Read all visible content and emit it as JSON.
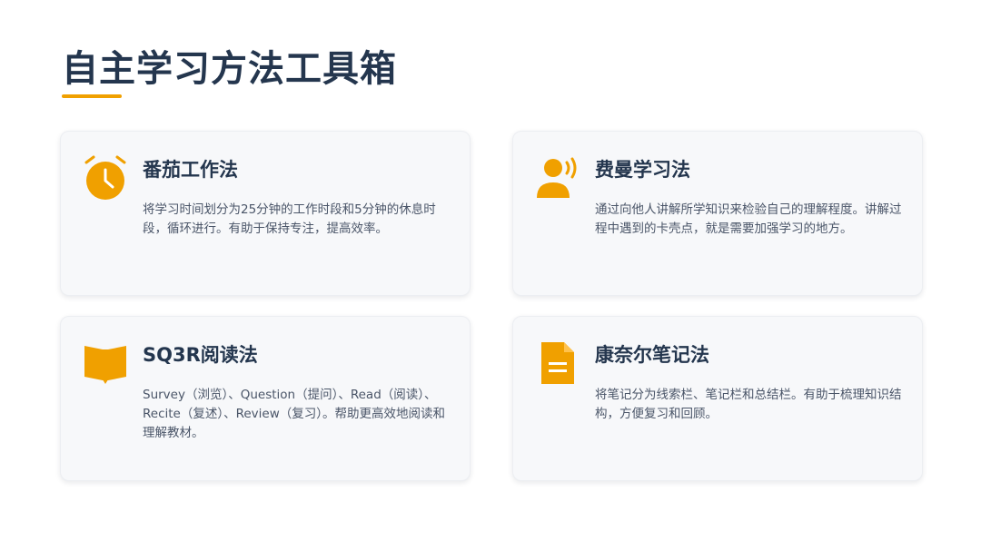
{
  "page": {
    "title": "自主学习方法工具箱"
  },
  "colors": {
    "accent": "#f0a000",
    "title": "#24364e",
    "text": "#4a5568",
    "card_bg": "#f7f8fa"
  },
  "cards": [
    {
      "icon": "alarm-clock-icon",
      "title": "番茄工作法",
      "desc": "将学习时间划分为25分钟的工作时段和5分钟的休息时段，循环进行。有助于保持专注，提高效率。"
    },
    {
      "icon": "person-speaking-icon",
      "title": "费曼学习法",
      "desc": "通过向他人讲解所学知识来检验自己的理解程度。讲解过程中遇到的卡壳点，就是需要加强学习的地方。"
    },
    {
      "icon": "open-book-icon",
      "title": "SQ3R阅读法",
      "desc": "Survey（浏览）、Question（提问）、Read（阅读）、Recite（复述）、Review（复习）。帮助更高效地阅读和理解教材。"
    },
    {
      "icon": "document-icon",
      "title": "康奈尔笔记法",
      "desc": "将笔记分为线索栏、笔记栏和总结栏。有助于梳理知识结构，方便复习和回顾。"
    }
  ]
}
